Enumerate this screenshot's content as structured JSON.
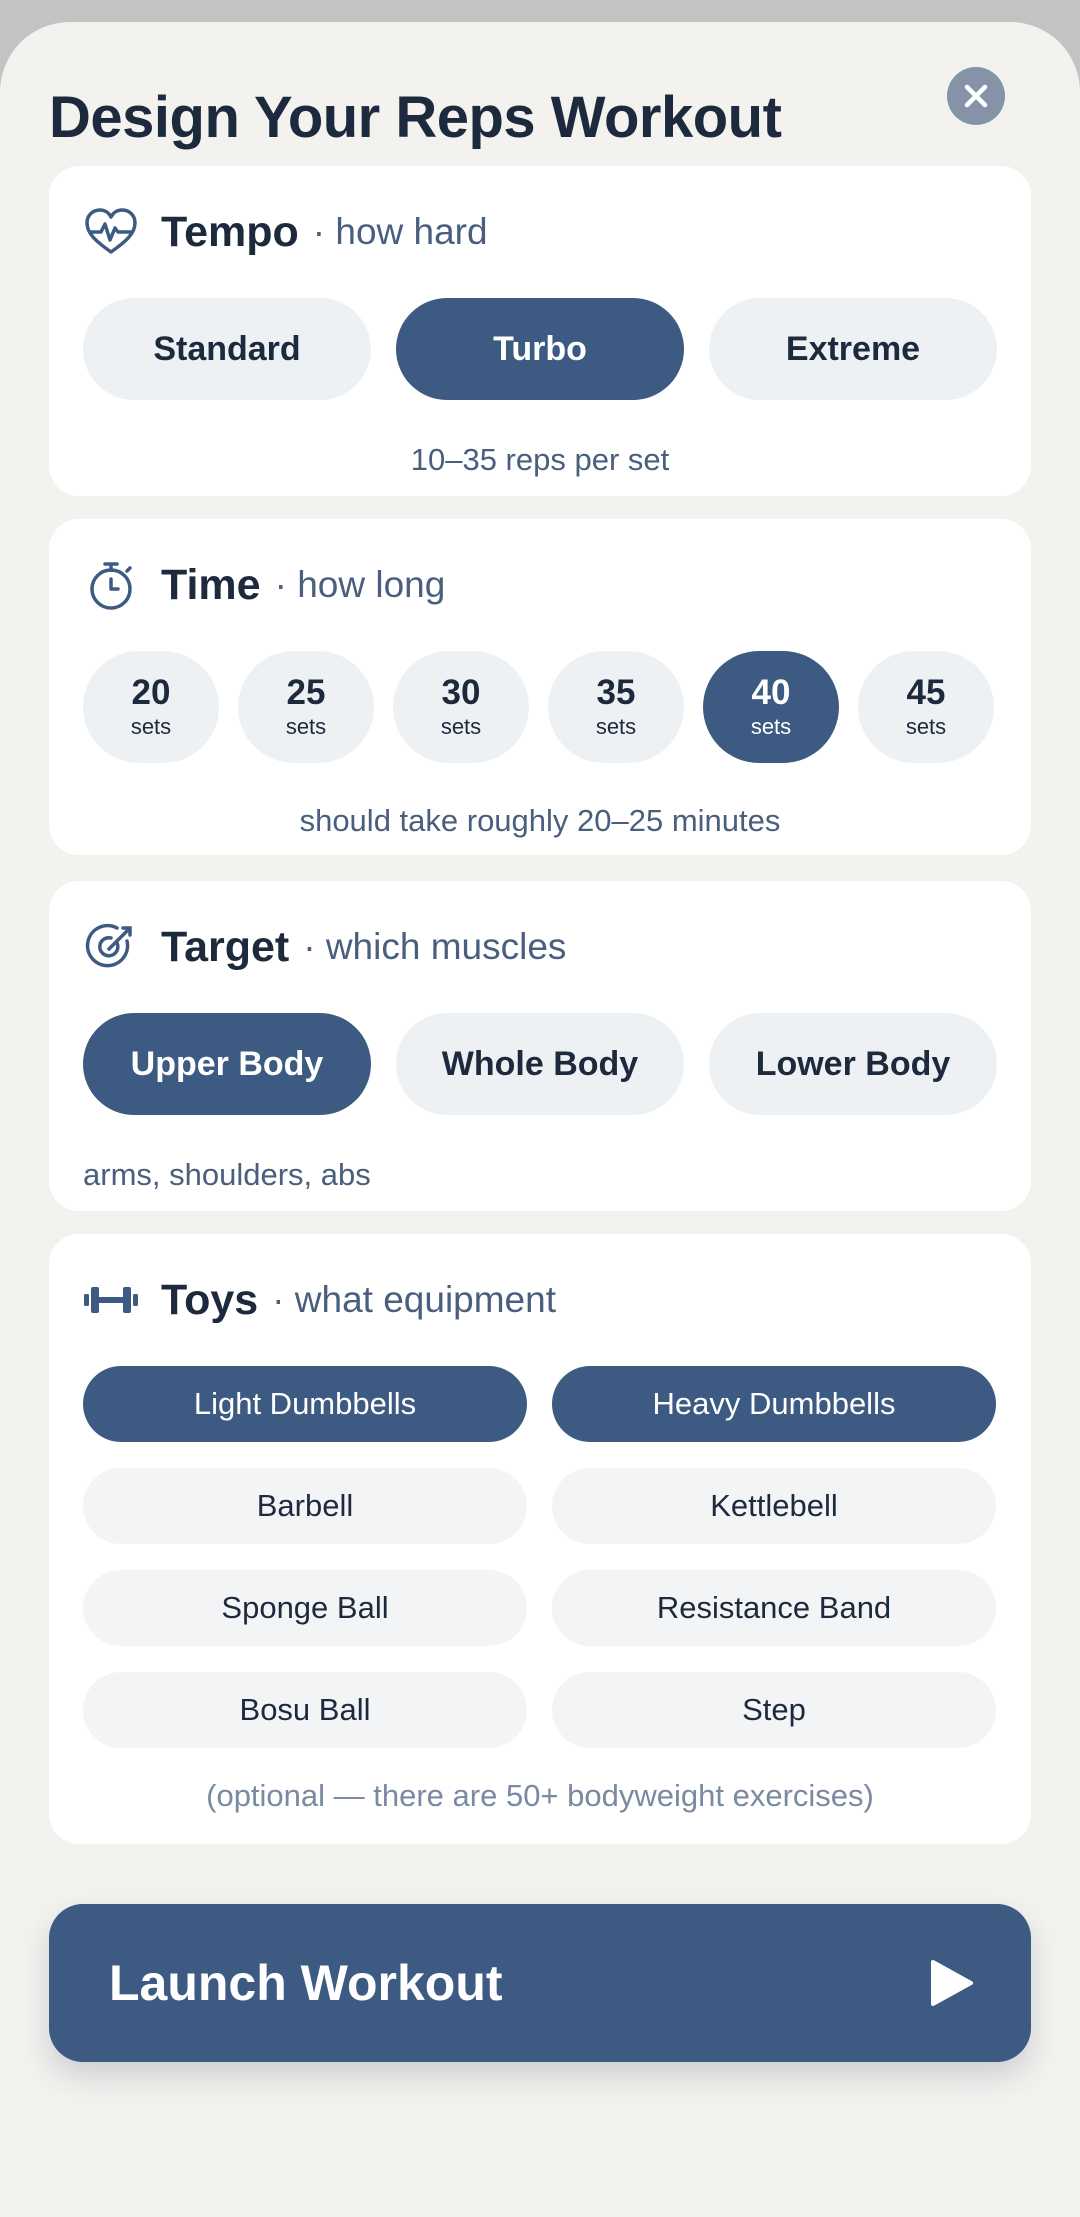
{
  "title": "Design Your Reps Workout",
  "colors": {
    "accent": "#3d5b82",
    "pill_bg": "#eef1f4",
    "card_bg": "#ffffff",
    "sheet_bg": "#f3f2ef"
  },
  "tempo": {
    "icon": "heartbeat-icon",
    "name": "Tempo",
    "sub": "· how hard",
    "options": [
      "Standard",
      "Turbo",
      "Extreme"
    ],
    "selected": "Turbo",
    "note": "10–35 reps per set"
  },
  "time": {
    "icon": "stopwatch-icon",
    "name": "Time",
    "sub": "· how long",
    "unit": "sets",
    "options": [
      "20",
      "25",
      "30",
      "35",
      "40",
      "45"
    ],
    "selected": "40",
    "note": "should take roughly 20–25 minutes"
  },
  "target": {
    "icon": "target-icon",
    "name": "Target",
    "sub": "· which muscles",
    "options": [
      "Upper Body",
      "Whole Body",
      "Lower Body"
    ],
    "selected": "Upper Body",
    "note": "arms, shoulders, abs"
  },
  "toys": {
    "icon": "dumbbell-icon",
    "name": "Toys",
    "sub": "· what equipment",
    "items": [
      "Light Dumbbells",
      "Heavy Dumbbells",
      "Barbell",
      "Kettlebell",
      "Sponge Ball",
      "Resistance Band",
      "Bosu Ball",
      "Step"
    ],
    "selected": [
      "Light Dumbbells",
      "Heavy Dumbbells"
    ],
    "note": "(optional — there are 50+ bodyweight exercises)"
  },
  "launch": {
    "label": "Launch Workout",
    "icon": "play-icon"
  },
  "close_icon": "close-icon"
}
